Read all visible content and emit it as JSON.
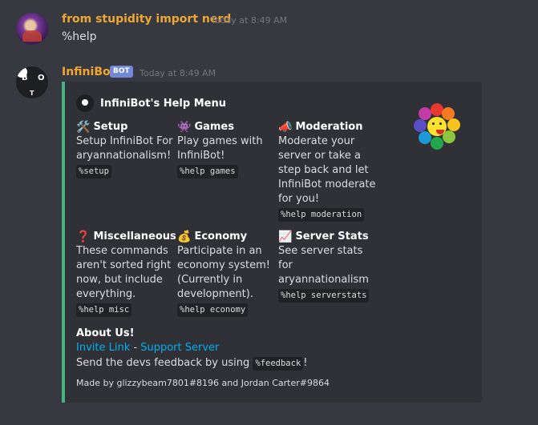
{
  "messages": [
    {
      "username": "from stupidity import nerd",
      "username_color": "#f0a732",
      "timestamp": "Today at 8:49 AM",
      "content": "%help"
    },
    {
      "username": "InfiniBot",
      "username_color": "#f0a732",
      "bot_tag": "BOT",
      "timestamp": "Today at 8:49 AM"
    }
  ],
  "embed": {
    "color": "#43b581",
    "author": "InfiniBot's Help Menu",
    "fields": [
      {
        "icon": "🛠️",
        "icon_name": "hammer-wrench-icon",
        "name": "Setup",
        "value": "Setup InfiniBot For aryannationalism!",
        "code": "%setup"
      },
      {
        "icon": "👾",
        "icon_name": "alien-monster-icon",
        "name": "Games",
        "value": "Play games with InfiniBot!",
        "code": "%help games"
      },
      {
        "icon": "📣",
        "icon_name": "megaphone-icon",
        "name": "Moderation",
        "value": "Moderate your server or take a step back and let InfiniBot moderate for you!",
        "code": "%help moderation"
      },
      {
        "icon": "❓",
        "icon_name": "question-mark-icon",
        "name": "Miscellaneous",
        "value": "These commands aren't sorted right now, but include everything.",
        "code": "%help misc"
      },
      {
        "icon": "💰",
        "icon_name": "money-bag-icon",
        "name": "Economy",
        "value": "Participate in an economy system! (Currently in development).",
        "code": "%help economy"
      },
      {
        "icon": "📈",
        "icon_name": "chart-increasing-icon",
        "name": "Server Stats",
        "value": "See server stats for aryannationalism",
        "code": "%help serverstats"
      }
    ],
    "about": {
      "title": "About Us!",
      "invite_link": "Invite Link",
      "separator": " - ",
      "support_link": "Support Server",
      "feedback_prefix": "Send the devs feedback by using ",
      "feedback_code": "%feedback",
      "feedback_suffix": "!"
    },
    "footer": "Made by glizzybeam7801#8196 and Jordan Carter#9864"
  }
}
